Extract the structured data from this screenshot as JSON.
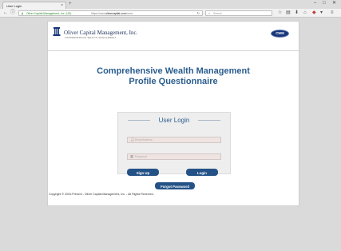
{
  "browser": {
    "tab_title": "User Login",
    "tab_close": "×",
    "new_tab": "+",
    "win_min": "–",
    "win_max": "□",
    "win_close": "✕",
    "url_org": "Oliver Capital Management, Inc. (US)",
    "url_prefix": "https://www.",
    "url_host": "olivercapital.com",
    "url_path": "/cwm/",
    "search_placeholder": "Search"
  },
  "header": {
    "company_name": "Oliver Capital Management, Inc.",
    "company_tagline": "COMPREHENSIVE WEALTH MANAGEMENT",
    "badge_text": "CWM"
  },
  "main": {
    "heading_line1": "Comprehensive Wealth Management",
    "heading_line2": "Profile Questionnaire"
  },
  "login": {
    "title": "User Login",
    "email_placeholder": "Email Address",
    "password_placeholder": "Password",
    "signup_label": "Sign Up",
    "login_label": "Login",
    "forgot_label": "Forgot Password"
  },
  "footer": {
    "copyright": "Copyright © 2003-Present - Oliver Capital Management, Inc. - All Rights Reserved."
  },
  "colors": {
    "accent": "#245287",
    "heading": "#2a5d8e",
    "brand_navy": "#16357b"
  }
}
